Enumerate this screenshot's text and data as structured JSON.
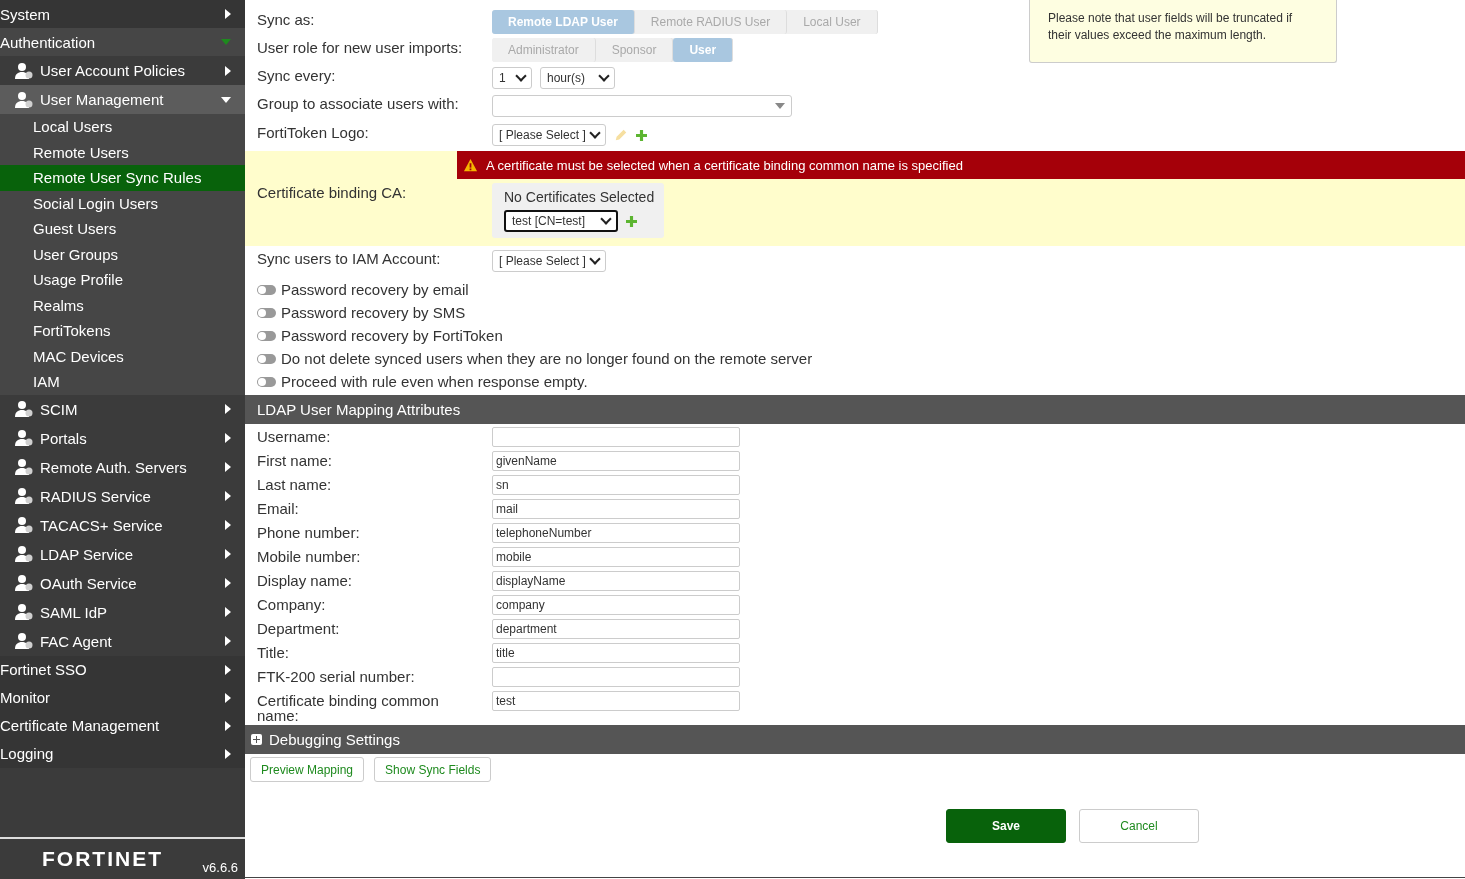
{
  "sidebar": {
    "items": [
      {
        "label": "System",
        "expanded": false
      },
      {
        "label": "Authentication",
        "expanded": true,
        "children": [
          {
            "label": "User Account Policies",
            "expanded": false
          },
          {
            "label": "User Management",
            "expanded": true,
            "children": [
              {
                "label": "Local Users",
                "selected": false
              },
              {
                "label": "Remote Users",
                "selected": false
              },
              {
                "label": "Remote User Sync Rules",
                "selected": true
              },
              {
                "label": "Social Login Users",
                "selected": false
              },
              {
                "label": "Guest Users",
                "selected": false
              },
              {
                "label": "User Groups",
                "selected": false
              },
              {
                "label": "Usage Profile",
                "selected": false
              },
              {
                "label": "Realms",
                "selected": false
              },
              {
                "label": "FortiTokens",
                "selected": false
              },
              {
                "label": "MAC Devices",
                "selected": false
              },
              {
                "label": "IAM",
                "selected": false
              }
            ]
          },
          {
            "label": "SCIM",
            "expanded": false
          },
          {
            "label": "Portals",
            "expanded": false
          },
          {
            "label": "Remote Auth. Servers",
            "expanded": false
          },
          {
            "label": "RADIUS Service",
            "expanded": false
          },
          {
            "label": "TACACS+ Service",
            "expanded": false
          },
          {
            "label": "LDAP Service",
            "expanded": false
          },
          {
            "label": "OAuth Service",
            "expanded": false
          },
          {
            "label": "SAML IdP",
            "expanded": false
          },
          {
            "label": "FAC Agent",
            "expanded": false
          }
        ]
      },
      {
        "label": "Fortinet SSO",
        "expanded": false
      },
      {
        "label": "Monitor",
        "expanded": false
      },
      {
        "label": "Certificate Management",
        "expanded": false
      },
      {
        "label": "Logging",
        "expanded": false
      }
    ],
    "logo": "FORTINET",
    "version": "v6.6.6"
  },
  "note": "Please note that user fields will be truncated if their values exceed the maximum length.",
  "form": {
    "sync_as": {
      "label": "Sync as:",
      "options": [
        {
          "label": "Remote LDAP User",
          "selected": true
        },
        {
          "label": "Remote RADIUS User",
          "selected": false
        },
        {
          "label": "Local User",
          "selected": false
        }
      ]
    },
    "user_role": {
      "label": "User role for new user imports:",
      "options": [
        {
          "label": "Administrator",
          "selected": false
        },
        {
          "label": "Sponsor",
          "selected": false
        },
        {
          "label": "User",
          "selected": true
        }
      ]
    },
    "sync_every": {
      "label": "Sync every:",
      "value": "1",
      "unit": "hour(s)"
    },
    "group": {
      "label": "Group to associate users with:"
    },
    "fortitoken_logo": {
      "label": "FortiToken Logo:",
      "value": "[ Please Select ]"
    },
    "error": "A certificate must be selected when a certificate binding common name is specified",
    "cert_ca": {
      "label": "Certificate binding CA:",
      "status": "No Certificates Selected",
      "value": "test [CN=test]"
    },
    "iam": {
      "label": "Sync users to IAM Account:",
      "value": "[ Please Select ]"
    },
    "toggles": [
      {
        "label": "Password recovery by email",
        "on": false
      },
      {
        "label": "Password recovery by SMS",
        "on": false
      },
      {
        "label": "Password recovery by FortiToken",
        "on": false
      },
      {
        "label": "Do not delete synced users when they are no longer found on the remote server",
        "on": false
      },
      {
        "label": "Proceed with rule even when response empty.",
        "on": false
      }
    ]
  },
  "mapping": {
    "title": "LDAP User Mapping Attributes",
    "rows": [
      {
        "label": "Username:"
      },
      {
        "label": "First name:",
        "value": "givenName"
      },
      {
        "label": "Last name:",
        "value": "sn"
      },
      {
        "label": "Email:",
        "value": "mail"
      },
      {
        "label": "Phone number:",
        "value": "telephoneNumber"
      },
      {
        "label": "Mobile number:",
        "value": "mobile"
      },
      {
        "label": "Display name:",
        "value": "displayName"
      },
      {
        "label": "Company:",
        "value": "company"
      },
      {
        "label": "Department:",
        "value": "department"
      },
      {
        "label": "Title:",
        "value": "title"
      },
      {
        "label": "FTK-200 serial number:"
      },
      {
        "label": "Certificate binding common name:",
        "value": "test"
      }
    ]
  },
  "debugging": {
    "title": "Debugging Settings",
    "expanded": false
  },
  "debug_buttons": [
    "Preview Mapping",
    "Show Sync Fields"
  ],
  "actions": {
    "save": "Save",
    "cancel": "Cancel"
  }
}
